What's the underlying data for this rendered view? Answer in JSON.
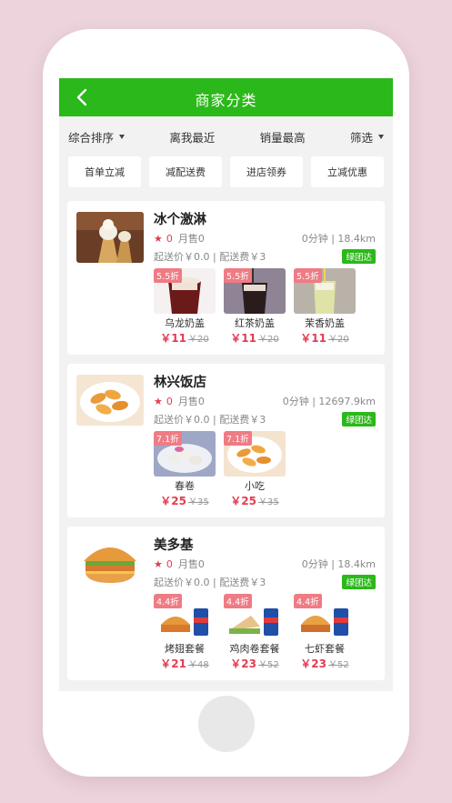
{
  "header": {
    "title": "商家分类"
  },
  "sort": [
    {
      "label": "综合排序",
      "dropdown": true
    },
    {
      "label": "离我最近",
      "dropdown": false
    },
    {
      "label": "销量最高",
      "dropdown": false
    },
    {
      "label": "筛选",
      "dropdown": true
    }
  ],
  "filters": [
    "首单立减",
    "减配送费",
    "进店领券",
    "立减优惠"
  ],
  "stores": [
    {
      "name": "冰个激淋",
      "rating": "0",
      "sales": "月售0",
      "time_distance": "0分钟 | 18.4km",
      "fees": "起送价￥0.0 | 配送费￥3",
      "badge": "绿团达",
      "dishes": [
        {
          "discount": "5.5折",
          "name": "乌龙奶盖",
          "price": "￥11",
          "old_price": "￥20"
        },
        {
          "discount": "5.5折",
          "name": "红茶奶盖",
          "price": "￥11",
          "old_price": "￥20"
        },
        {
          "discount": "5.5折",
          "name": "茉香奶盖",
          "price": "￥11",
          "old_price": "￥20"
        }
      ]
    },
    {
      "name": "林兴饭店",
      "rating": "0",
      "sales": "月售0",
      "time_distance": "0分钟 | 12697.9km",
      "fees": "起送价￥0.0 | 配送费￥3",
      "badge": "绿团达",
      "dishes": [
        {
          "discount": "7.1折",
          "name": "春卷",
          "price": "￥25",
          "old_price": "￥35"
        },
        {
          "discount": "7.1折",
          "name": "小吃",
          "price": "￥25",
          "old_price": "￥35"
        }
      ]
    },
    {
      "name": "美多基",
      "rating": "0",
      "sales": "月售0",
      "time_distance": "0分钟 | 18.4km",
      "fees": "起送价￥0.0 | 配送费￥3",
      "badge": "绿团达",
      "dishes": [
        {
          "discount": "4.4折",
          "name": "烤翅套餐",
          "price": "￥21",
          "old_price": "￥48"
        },
        {
          "discount": "4.4折",
          "name": "鸡肉卷套餐",
          "price": "￥23",
          "old_price": "￥52"
        },
        {
          "discount": "4.4折",
          "name": "七虾套餐",
          "price": "￥23",
          "old_price": "￥52"
        }
      ]
    }
  ],
  "colors": {
    "accent": "#2bb81a",
    "price": "#e53b52",
    "discount": "#ef7b84",
    "background": "#ecd3dc"
  }
}
